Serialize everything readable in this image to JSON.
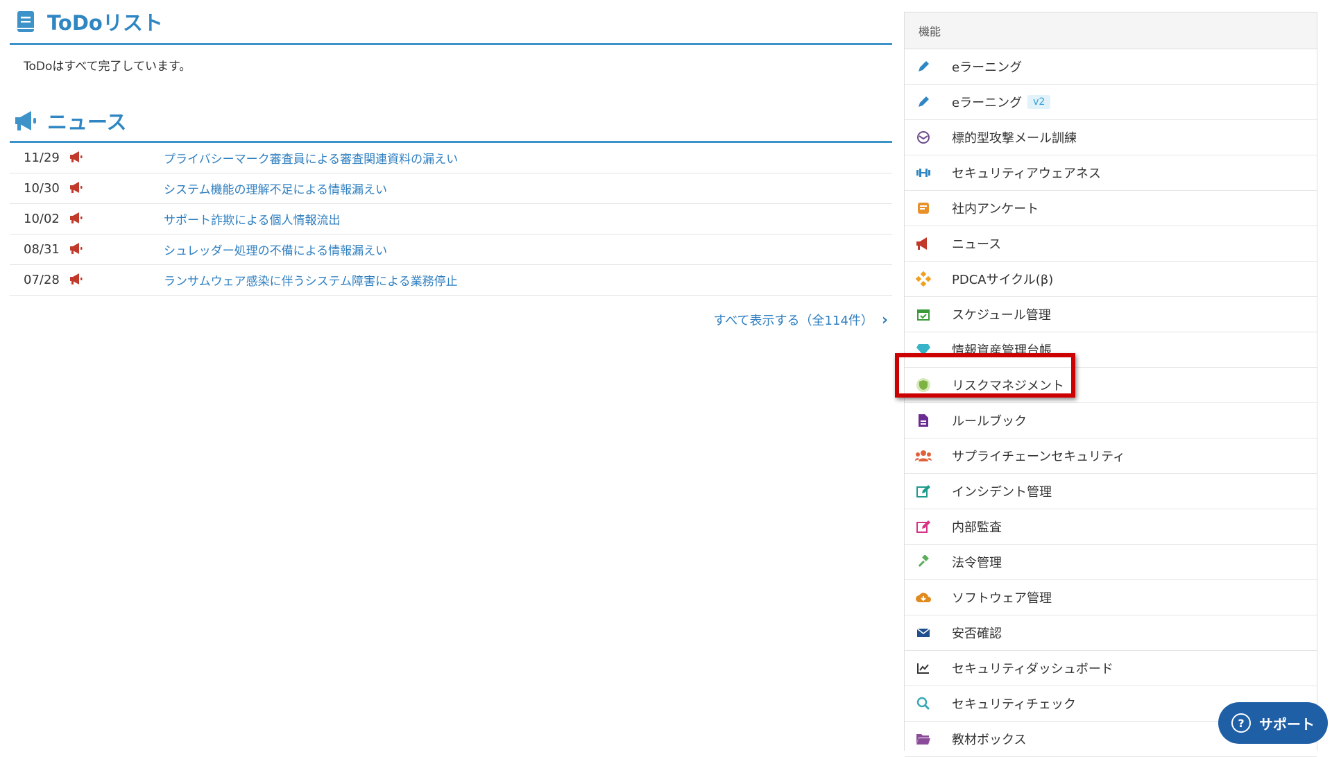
{
  "todo": {
    "title": "ToDoリスト",
    "message": "ToDoはすべて完了しています。"
  },
  "news": {
    "title": "ニュース",
    "items": [
      {
        "date": "11/29",
        "title": "プライバシーマーク審査員による審査関連資料の漏えい"
      },
      {
        "date": "10/30",
        "title": "システム機能の理解不足による情報漏えい"
      },
      {
        "date": "10/02",
        "title": "サポート詐欺による個人情報流出"
      },
      {
        "date": "08/31",
        "title": "シュレッダー処理の不備による情報漏えい"
      },
      {
        "date": "07/28",
        "title": "ランサムウェア感染に伴うシステム障害による業務停止"
      }
    ],
    "show_all": "すべて表示する（全114件）"
  },
  "features": {
    "header": "機能",
    "items": [
      {
        "label": "eラーニング",
        "icon": "pencil-icon",
        "color": "#2f86c2"
      },
      {
        "label": "eラーニング",
        "badge": "v2",
        "icon": "pencil-icon",
        "color": "#2f86c2"
      },
      {
        "label": "標的型攻撃メール訓練",
        "icon": "mail-attack-icon",
        "color": "#6b4c8a"
      },
      {
        "label": "セキュリティアウェアネス",
        "icon": "dumbbell-icon",
        "color": "#2f86c2"
      },
      {
        "label": "社内アンケート",
        "icon": "survey-icon",
        "color": "#e8902a"
      },
      {
        "label": "ニュース",
        "icon": "megaphone-icon",
        "color": "#c0392b"
      },
      {
        "label": "PDCAサイクル(β)",
        "icon": "cycle-icon",
        "color": "#f0a020"
      },
      {
        "label": "スケジュール管理",
        "icon": "calendar-check-icon",
        "color": "#3a9a3a"
      },
      {
        "label": "情報資産管理台帳",
        "icon": "diamond-icon",
        "color": "#38b4c8"
      },
      {
        "label": "リスクマネジメント",
        "icon": "shield-icon",
        "color": "#7cb342"
      },
      {
        "label": "ルールブック",
        "icon": "document-icon",
        "color": "#6a2c91"
      },
      {
        "label": "サプライチェーンセキュリティ",
        "icon": "users-icon",
        "color": "#e0603a"
      },
      {
        "label": "インシデント管理",
        "icon": "edit-icon",
        "color": "#1e9a8a"
      },
      {
        "label": "内部監査",
        "icon": "edit-icon",
        "color": "#d63384"
      },
      {
        "label": "法令管理",
        "icon": "gavel-icon",
        "color": "#5cae5c"
      },
      {
        "label": "ソフトウェア管理",
        "icon": "cloud-download-icon",
        "color": "#e08a20"
      },
      {
        "label": "安否確認",
        "icon": "envelope-icon",
        "color": "#1f4f8f"
      },
      {
        "label": "セキュリティダッシュボード",
        "icon": "line-chart-icon",
        "color": "#333333"
      },
      {
        "label": "セキュリティチェック",
        "icon": "search-icon",
        "color": "#38a8b8"
      },
      {
        "label": "教材ボックス",
        "icon": "folder-open-icon",
        "color": "#8a4c9a"
      }
    ]
  },
  "support": {
    "label": "サポート",
    "icon": "question-circle-icon"
  },
  "colors": {
    "accent": "#2f86c2",
    "news_icon": "#c0392b",
    "highlight": "#cc0000",
    "support_bg": "#1f5fa6"
  }
}
